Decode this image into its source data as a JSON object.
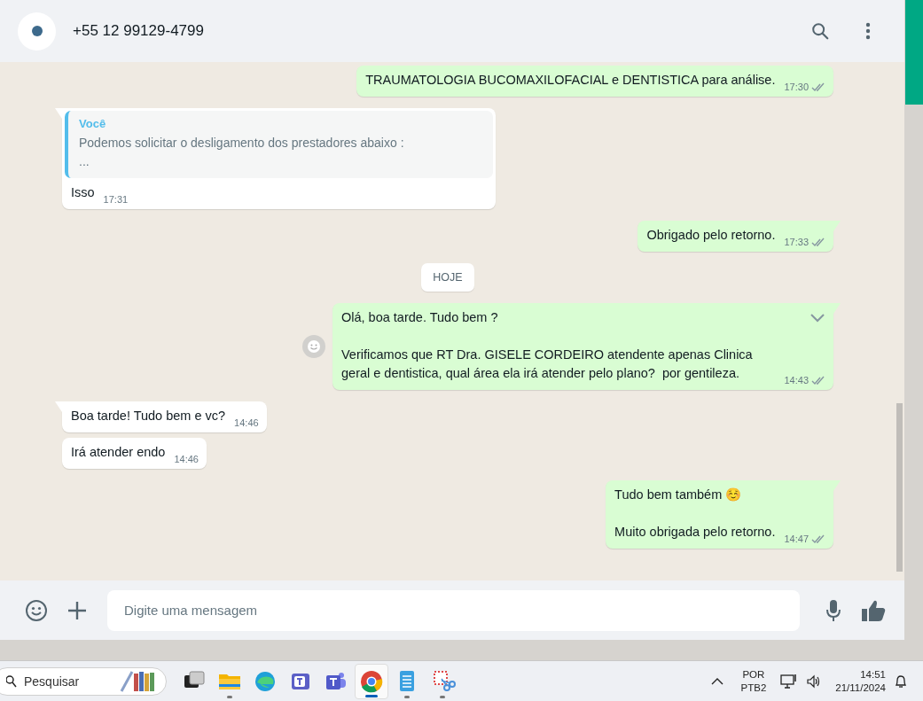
{
  "header": {
    "contact": "+55 12 99129-4799"
  },
  "messages": [
    {
      "kind": "outgoing",
      "tail": false,
      "hovered": false,
      "text": "TRAUMATOLOGIA BUCOMAXILOFACIAL e DENTISTICA para análise.",
      "time": "17:30",
      "read": false
    },
    {
      "kind": "incoming",
      "tail": true,
      "hovered": false,
      "quote": {
        "author": "Você",
        "text": "Podemos solicitar o desligamento dos prestadores abaixo :",
        "more": "..."
      },
      "text": "Isso",
      "time": "17:31"
    },
    {
      "kind": "outgoing",
      "tail": true,
      "hovered": false,
      "text": "Obrigado pelo retorno.",
      "time": "17:33",
      "read": false
    },
    {
      "kind": "date",
      "text": "HOJE"
    },
    {
      "kind": "outgoing",
      "tail": true,
      "hovered": true,
      "text": "Olá, boa tarde. Tudo bem ?\n\nVerificamos que RT Dra. GISELE CORDEIRO atendente apenas Clinica geral e dentistica, qual área ela irá atender pelo plano?  por gentileza.",
      "time": "14:43",
      "read": false
    },
    {
      "kind": "incoming",
      "tail": true,
      "hovered": false,
      "text": "Boa tarde! Tudo bem e vc?",
      "time": "14:46"
    },
    {
      "kind": "incoming",
      "tail": false,
      "hovered": false,
      "text": "Irá atender endo",
      "time": "14:46"
    },
    {
      "kind": "outgoing",
      "tail": true,
      "hovered": false,
      "text": "Tudo bem também ☺️\n\nMuito obrigada pelo retorno.",
      "time": "14:47",
      "read": false
    }
  ],
  "composer": {
    "placeholder": "Digite uma mensagem"
  },
  "taskbar": {
    "search": {
      "placeholder": "Pesquisar"
    },
    "apps": [
      {
        "kind": "taskview",
        "selected": false,
        "running": false
      },
      {
        "kind": "folder",
        "selected": false,
        "running": true
      },
      {
        "kind": "browser",
        "selected": false,
        "running": false
      },
      {
        "kind": "chat",
        "selected": false,
        "running": false
      },
      {
        "kind": "team",
        "selected": false,
        "running": false
      },
      {
        "kind": "chrome",
        "selected": true,
        "running": true
      },
      {
        "kind": "notepad",
        "selected": false,
        "running": true
      },
      {
        "kind": "snip",
        "selected": false,
        "running": true
      }
    ],
    "language": [
      "POR",
      "PTB2"
    ],
    "time": "14:51",
    "date": "21/11/2024"
  }
}
